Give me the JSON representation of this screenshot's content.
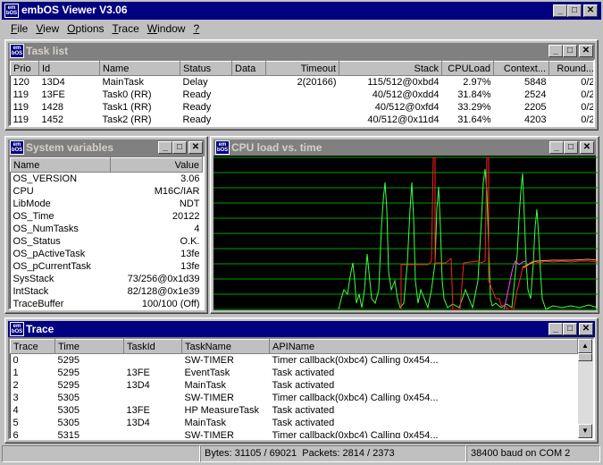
{
  "app": {
    "title": "embOS Viewer V3.06",
    "icon_text": "em\nbOS"
  },
  "menu": [
    {
      "label": "File",
      "mnemonic": "F",
      "rest": "ile"
    },
    {
      "label": "View",
      "mnemonic": "V",
      "rest": "iew"
    },
    {
      "label": "Options",
      "mnemonic": "O",
      "rest": "ptions"
    },
    {
      "label": "Trace",
      "mnemonic": "T",
      "rest": "race"
    },
    {
      "label": "Window",
      "mnemonic": "W",
      "rest": "indow"
    },
    {
      "label": "?",
      "mnemonic": "?",
      "rest": ""
    }
  ],
  "tasklist": {
    "title": "Task list",
    "columns": [
      "Prio",
      "Id",
      "Name",
      "Status",
      "Data",
      "Timeout",
      "Stack",
      "CPULoad",
      "Context...",
      "Round..."
    ],
    "rows": [
      [
        "120",
        "13D4",
        "MainTask",
        "Delay",
        "",
        "2(20166)",
        "115/512@0xbd4",
        "2.97%",
        "5848",
        "0/2"
      ],
      [
        "119",
        "13FE",
        "Task0 (RR)",
        "Ready",
        "",
        "",
        "40/512@0xdd4",
        "31.84%",
        "2524",
        "0/2"
      ],
      [
        "119",
        "1428",
        "Task1 (RR)",
        "Ready",
        "",
        "",
        "40/512@0xfd4",
        "33.29%",
        "2205",
        "0/2"
      ],
      [
        "119",
        "1452",
        "Task2 (RR)",
        "Ready",
        "",
        "",
        "40/512@0x11d4",
        "31.64%",
        "4203",
        "0/2"
      ]
    ]
  },
  "sysvars": {
    "title": "System variables",
    "columns": [
      "Name",
      "Value"
    ],
    "rows": [
      [
        "OS_VERSION",
        "3.06"
      ],
      [
        "CPU",
        "M16C/IAR"
      ],
      [
        "LibMode",
        "NDT"
      ],
      [
        "OS_Time",
        "20122"
      ],
      [
        "OS_NumTasks",
        "4"
      ],
      [
        "OS_Status",
        "O.K."
      ],
      [
        "OS_pActiveTask",
        "13fe"
      ],
      [
        "OS_pCurrentTask",
        "13fe"
      ],
      [
        "SysStack",
        "73/256@0x1d39"
      ],
      [
        "IntStack",
        "82/128@0x1e39"
      ],
      [
        "TraceBuffer",
        "100/100 (Off)"
      ]
    ]
  },
  "cpuload": {
    "title": "CPU load vs. time"
  },
  "trace": {
    "title": "Trace",
    "columns": [
      "Trace",
      "Time",
      "TaskId",
      "TaskName",
      "APIName"
    ],
    "rows": [
      [
        "0",
        "5295",
        "",
        "SW-TIMER",
        "Timer callback(0xbc4) Calling 0x454..."
      ],
      [
        "1",
        "5295",
        "13FE",
        "EventTask",
        "Task activated"
      ],
      [
        "2",
        "5295",
        "13D4",
        "MainTask",
        "Task activated"
      ],
      [
        "3",
        "5305",
        "",
        "SW-TIMER",
        "Timer callback(0xbc4) Calling 0x454..."
      ],
      [
        "4",
        "5305",
        "13FE",
        "HP MeasureTask",
        "Task activated"
      ],
      [
        "5",
        "5305",
        "13D4",
        "MainTask",
        "Task activated"
      ],
      [
        "6",
        "5315",
        "",
        "SW-TIMER",
        "Timer callback(0xbc4) Calling 0x454..."
      ]
    ]
  },
  "status": {
    "bytes": "Bytes: 31105 / 69021",
    "packets": "Packets: 2814 / 2373",
    "connection": "38400 baud on COM 2"
  },
  "colors": {
    "titlebar_active": "#000080",
    "titlebar_inactive": "#808080",
    "plot_bg": "#000000",
    "grid": "#00a000",
    "trace_green": "#40ff40",
    "trace_red": "#ff2020",
    "trace_magenta": "#ff40ff",
    "trace_orange": "#ffa060"
  }
}
